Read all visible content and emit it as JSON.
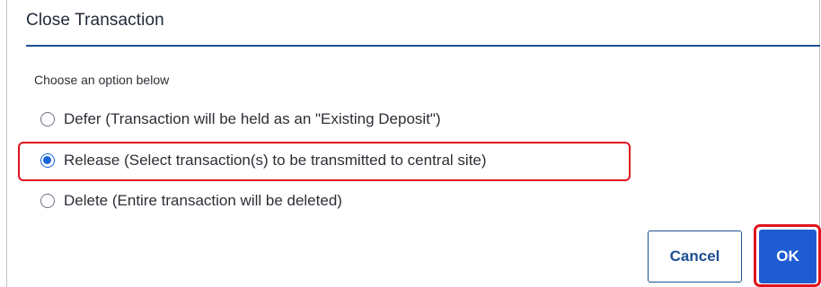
{
  "dialog": {
    "title": "Close Transaction",
    "prompt": "Choose an option below",
    "options": [
      {
        "label": "Defer (Transaction will be held as an \"Existing Deposit\")",
        "selected": false
      },
      {
        "label": "Release (Select transaction(s) to be transmitted to central site)",
        "selected": true
      },
      {
        "label": "Delete (Entire transaction will be deleted)",
        "selected": false
      }
    ],
    "buttons": {
      "cancel": "Cancel",
      "ok": "OK"
    }
  },
  "colors": {
    "accent": "#1f5cd1",
    "title_rule": "#1d4f91",
    "highlight": "#e0141e"
  }
}
